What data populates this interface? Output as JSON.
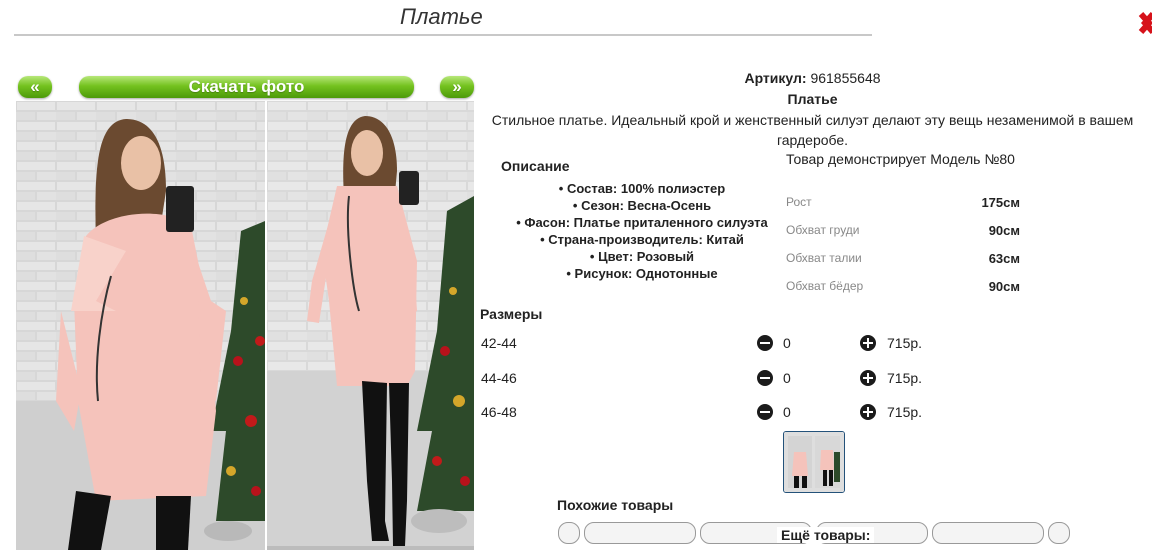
{
  "page": {
    "title": "Платье"
  },
  "gallery": {
    "prev_label": "«",
    "download_label": "Скачать фото",
    "next_label": "»"
  },
  "product": {
    "article_label": "Артикул:",
    "article_value": "961855648",
    "name": "Платье",
    "description": "Стильное платье. Идеальный крой и женственный силуэт делают эту вещь незаменимой в вашем гардеробе.",
    "model_note": "Товар демонстрирует Модель №80"
  },
  "details": {
    "heading": "Описание",
    "items": [
      "• Состав: 100% полиэстер",
      "• Сезон: Весна-Осень",
      "• Фасон: Платье приталенного силуэта",
      "• Страна-производитель: Китай",
      "• Цвет: Розовый",
      "• Рисунок: Однотонные"
    ]
  },
  "measurements": [
    {
      "label": "Рост",
      "value": "175см"
    },
    {
      "label": "Обхват груди",
      "value": "90см"
    },
    {
      "label": "Обхват талии",
      "value": "63см"
    },
    {
      "label": "Обхват бёдер",
      "value": "90см"
    }
  ],
  "sizes": {
    "heading": "Размеры",
    "rows": [
      {
        "size": "42-44",
        "qty": "0",
        "price": "715р."
      },
      {
        "size": "44-46",
        "qty": "0",
        "price": "715р."
      },
      {
        "size": "46-48",
        "qty": "0",
        "price": "715р."
      }
    ]
  },
  "similar": {
    "heading": "Похожие товары"
  },
  "more": {
    "heading": "Ещё товары:"
  },
  "colors": {
    "green": "#74c21f",
    "dress_pink": "#f5c3bb",
    "close_red": "#d6121a"
  }
}
